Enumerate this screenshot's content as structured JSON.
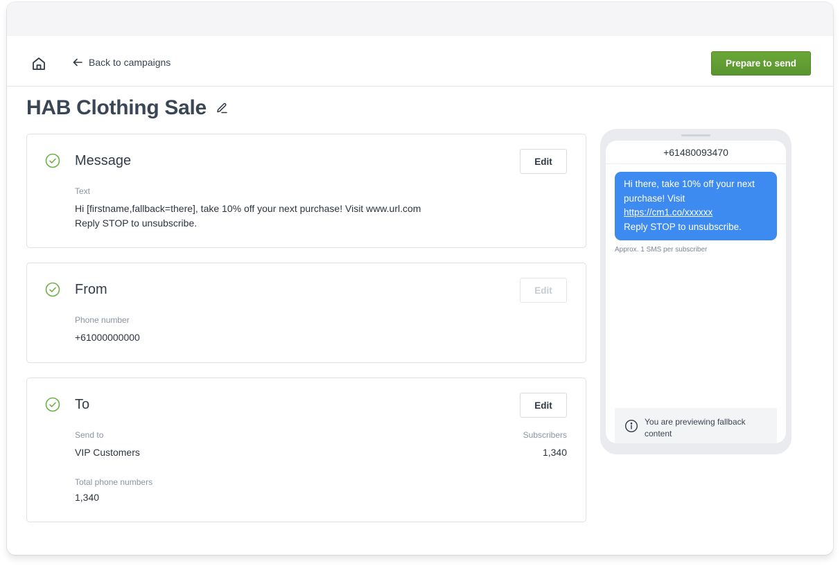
{
  "topbar": {
    "home_icon": "home-icon",
    "back_label": "Back to campaigns",
    "back_icon": "arrow-left-icon",
    "primary_button": "Prepare to send"
  },
  "page": {
    "title": "HAB Clothing Sale",
    "title_edit_icon": "pencil-icon"
  },
  "colors": {
    "accent_green": "#5e9b33",
    "check_green": "#6bb043",
    "bubble_blue": "#3d8af0"
  },
  "cards": {
    "message": {
      "title": "Message",
      "status_icon": "check-circle-icon",
      "edit_label": "Edit",
      "edit_enabled": true,
      "text_label": "Text",
      "text_line1": "Hi [firstname,fallback=there], take 10% off your next purchase! Visit www.url.com",
      "text_line2": "Reply STOP to unsubscribe."
    },
    "from": {
      "title": "From",
      "status_icon": "check-circle-icon",
      "edit_label": "Edit",
      "edit_enabled": false,
      "phone_label": "Phone number",
      "phone_value": "+61000000000"
    },
    "to": {
      "title": "To",
      "status_icon": "check-circle-icon",
      "edit_label": "Edit",
      "edit_enabled": true,
      "send_to_label": "Send to",
      "send_to_value": "VIP Customers",
      "subscribers_label": "Subscribers",
      "subscribers_value": "1,340",
      "total_label": "Total phone numbers",
      "total_value": "1,340"
    }
  },
  "preview": {
    "phone_number": "+61480093470",
    "bubble_line1": "Hi there, take 10% off your next purchase! Visit",
    "bubble_link": "https://cm1.co/xxxxxx",
    "bubble_line3": "Reply STOP to unsubscribe.",
    "sms_count": "Approx. 1 SMS per subscriber",
    "fallback_note": "You are previewing fallback content",
    "info_icon": "info-icon"
  }
}
